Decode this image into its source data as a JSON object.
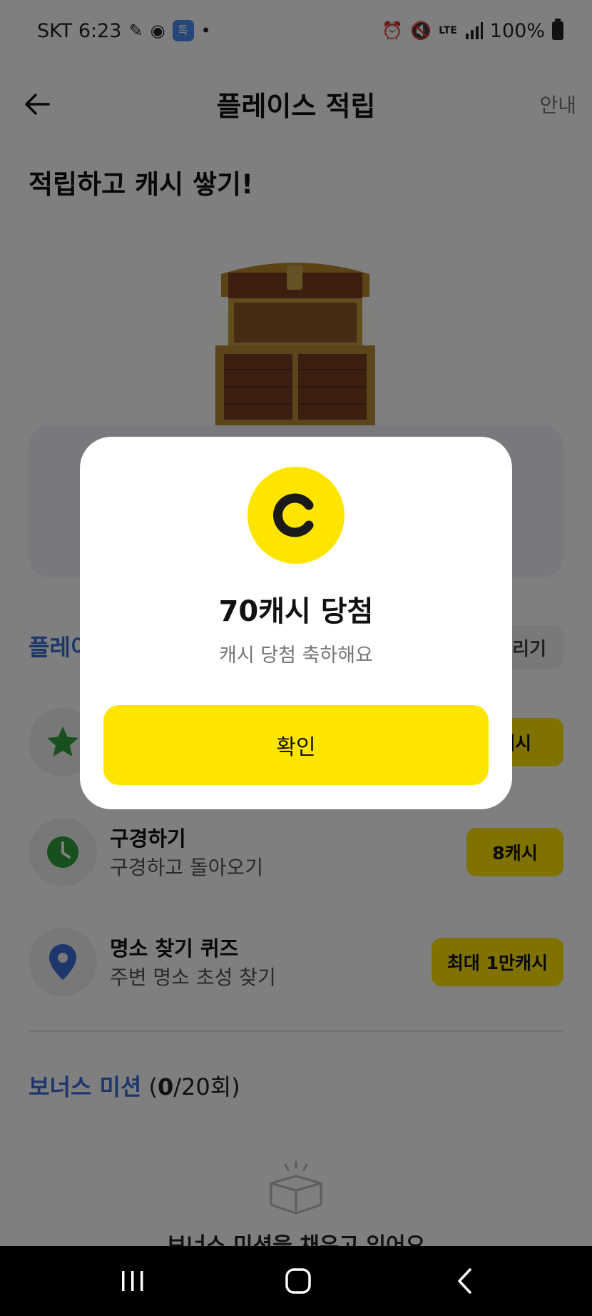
{
  "status_bar": {
    "carrier_time": "SKT 6:23",
    "network": "LTE",
    "battery": "100%",
    "app_badge": "톡",
    "icons": [
      "edit-icon",
      "notification-icon",
      "alarm-icon",
      "mute-icon",
      "signal-icon",
      "battery-icon"
    ]
  },
  "header": {
    "title": "플레이스 적립",
    "back_icon": "back-arrow-icon",
    "guide_label": "안내"
  },
  "hero": {
    "title": "적립하고 캐시 쌓기!"
  },
  "missions_section": {
    "title_partial": "플레이",
    "right_chip_partial": "늘리기"
  },
  "missions": [
    {
      "icon": "star-icon",
      "title": "",
      "subtitle": "",
      "reward": "캐시"
    },
    {
      "icon": "clock-icon",
      "title": "구경하기",
      "subtitle": "구경하고 돌아오기",
      "reward": "8캐시"
    },
    {
      "icon": "location-pin-icon",
      "title": "명소 찾기 퀴즈",
      "subtitle": "주변 명소 초성 찾기",
      "reward": "최대 1만캐시"
    }
  ],
  "bonus": {
    "title": "보너스 미션",
    "count_open": "(",
    "count_current": "0",
    "count_rest": "/20회)"
  },
  "empty_state": {
    "text": "보너스 미션을 채우고 있어요"
  },
  "dialog": {
    "coin_letter": "C",
    "title": "70캐시 당첨",
    "subtitle": "캐시 당첨 축하해요",
    "confirm_label": "확인"
  },
  "colors": {
    "accent_yellow": "#FEE500",
    "accent_blue": "#3A6FD8",
    "star_green": "#2E9E3E",
    "pin_blue": "#3A6FD8"
  }
}
